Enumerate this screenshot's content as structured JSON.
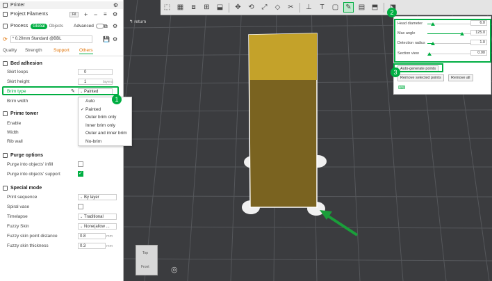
{
  "panel": {
    "printer_label": "Printer",
    "project_filaments_label": "Project Filaments",
    "filament_badge": "Fil",
    "process_label": "Process",
    "global_tab": "Global",
    "objects_tab": "Objects",
    "advanced_label": "Advanced",
    "preset_name": "* 0.20mm Standard @BBL",
    "tabs": [
      "Quality",
      "Strength",
      "Support",
      "Others"
    ],
    "bed_adhesion": {
      "title": "Bed adhesion",
      "skirt_loops_label": "Skirt loops",
      "skirt_loops_value": "0",
      "skirt_height_label": "Skirt height",
      "skirt_height_value": "1",
      "skirt_height_unit": "layers",
      "brim_type_label": "Brim type",
      "brim_type_value": "Painted",
      "brim_width_label": "Brim width"
    },
    "brim_options": [
      "Auto",
      "Painted",
      "Outer brim only",
      "Inner brim only",
      "Outer and inner brim",
      "No-brim"
    ],
    "brim_selected": "Painted",
    "prime_tower": {
      "title": "Prime tower",
      "enable_label": "Enable",
      "width_label": "Width",
      "rib_wall_label": "Rib wall"
    },
    "purge": {
      "title": "Purge options",
      "infill_label": "Purge into objects' infill",
      "support_label": "Purge into objects' support"
    },
    "special": {
      "title": "Special mode",
      "print_sequence_label": "Print sequence",
      "print_sequence_value": "By layer",
      "spiral_vase_label": "Spiral vase",
      "timelapse_label": "Timelapse",
      "timelapse_value": "Traditional",
      "fuzzy_skin_label": "Fuzzy Skin",
      "fuzzy_skin_value": "None(allow ...",
      "fuzzy_point_label": "Fuzzy skin point distance",
      "fuzzy_point_value": "0.8",
      "fuzzy_point_unit": "mm",
      "fuzzy_thick_label": "Fuzzy skin thickness",
      "fuzzy_thick_value": "0.3",
      "fuzzy_thick_unit": "mm"
    }
  },
  "viewport": {
    "return_label": "return",
    "nav_cube_top": "Top",
    "nav_cube_front": "Front"
  },
  "support_panel": {
    "head_diameter_label": "Head diameter",
    "head_diameter_value": "6.0",
    "max_angle_label": "Max angle",
    "max_angle_value": "125.0",
    "detection_radius_label": "Detection radius",
    "detection_radius_value": "1.0",
    "section_view_label": "Section view",
    "section_view_value": "0.00",
    "auto_generate_label": "Auto-generate points",
    "remove_selected_label": "Remove selected points",
    "remove_all_label": "Remove all"
  },
  "annotations": {
    "badge1": "1",
    "badge2": "2",
    "badge3": "3"
  },
  "colors": {
    "accent": "#00ae42",
    "object_top": "#c4a22a",
    "object_body": "#7a6320",
    "grid_bg": "#3b3c3f"
  }
}
